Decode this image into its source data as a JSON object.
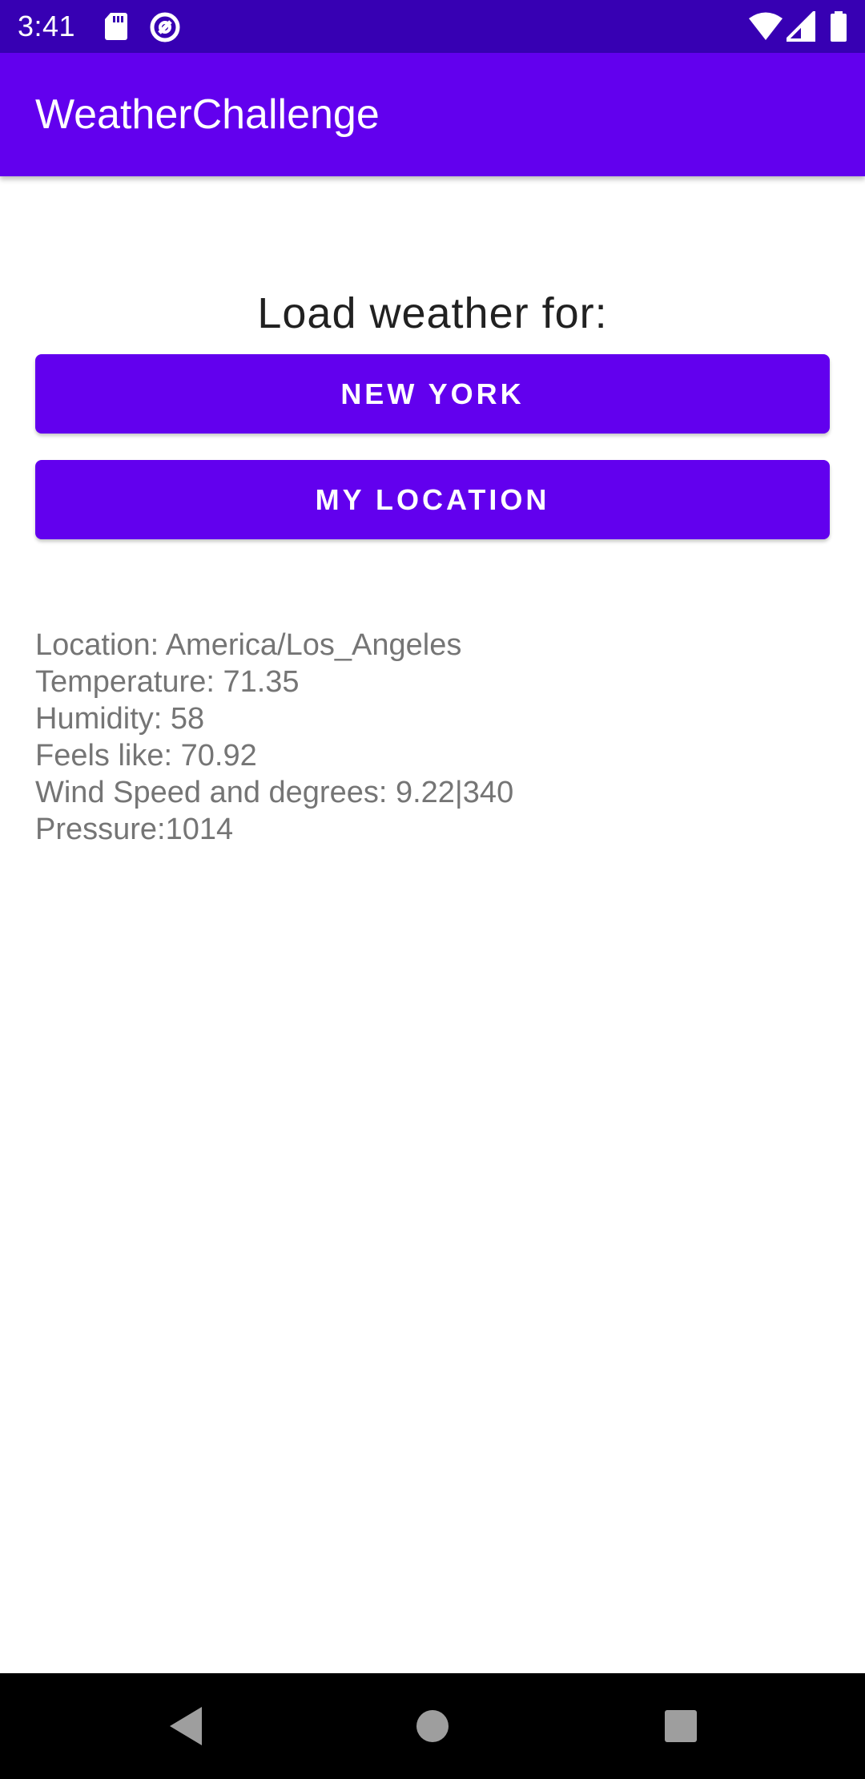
{
  "status_bar": {
    "time": "3:41",
    "icons": [
      "sd-card-icon",
      "data-saver-icon",
      "wifi-icon",
      "signal-icon",
      "battery-icon"
    ]
  },
  "app_bar": {
    "title": "WeatherChallenge"
  },
  "main": {
    "prompt": "Load weather for:",
    "buttons": {
      "new_york": "NEW YORK",
      "my_location": "MY LOCATION"
    },
    "weather_info": {
      "location": "Location: America/Los_Angeles",
      "temperature": "Temperature: 71.35",
      "humidity": "Humidity: 58",
      "feels_like": "Feels like: 70.92",
      "wind": "Wind Speed and degrees: 9.22|340",
      "pressure": "Pressure:1014"
    }
  },
  "nav_bar": {
    "icons": [
      "back-icon",
      "home-icon",
      "recents-icon"
    ]
  },
  "colors": {
    "status_bar": "#3700b3",
    "primary": "#6200ee",
    "prompt_text": "#212121",
    "info_text": "#757575"
  }
}
